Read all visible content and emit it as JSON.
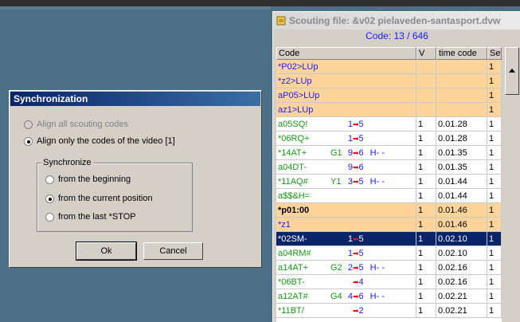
{
  "scouting": {
    "title": "Scouting file: &v02 pielaveden-santasport.dvw",
    "code_counter": "Code: 13 / 646",
    "headers": {
      "code": "Code",
      "v": "V",
      "time": "time code",
      "set": "Set"
    },
    "rows": [
      {
        "code": "*P02>LUp",
        "v": "",
        "time": "",
        "set": "1",
        "style": "orange"
      },
      {
        "code": "*z2>LUp",
        "v": "",
        "time": "",
        "set": "1",
        "style": "orange"
      },
      {
        "code": "aP05>LUp",
        "v": "",
        "time": "",
        "set": "1",
        "style": "orange"
      },
      {
        "code": "az1>LUp",
        "v": "",
        "time": "",
        "set": "1",
        "style": "orange"
      },
      {
        "code": "a05SQ!",
        "p1": "",
        "p2": "1",
        "p3": "5",
        "extra": "",
        "v": "1",
        "time": "0.01.28",
        "set": "1",
        "style": "white"
      },
      {
        "code": "*06RQ+",
        "p1": "",
        "p2": "1",
        "p3": "5",
        "extra": "",
        "v": "1",
        "time": "0.01.28",
        "set": "1",
        "style": "white"
      },
      {
        "code": "*14AT+",
        "p1": "G1",
        "p2": "9",
        "p3": "6",
        "extra": "H- -",
        "v": "1",
        "time": "0.01.35",
        "set": "1",
        "style": "white"
      },
      {
        "code": "a04DT-",
        "p1": "",
        "p2": "9",
        "p3": "6",
        "extra": "",
        "v": "1",
        "time": "0.01.35",
        "set": "1",
        "style": "white"
      },
      {
        "code": "*11AQ#",
        "p1": "Y1",
        "p2": "3",
        "p3": "5",
        "extra": "H- -",
        "v": "1",
        "time": "0.01.44",
        "set": "1",
        "style": "white"
      },
      {
        "code": "a$$&H=",
        "p1": "",
        "p2": "",
        "p3": "",
        "extra": "",
        "v": "1",
        "time": "0.01.44",
        "set": "1",
        "style": "white"
      },
      {
        "code": "*p01:00",
        "v": "1",
        "time": "0.01.46",
        "set": "1",
        "style": "orange-bold"
      },
      {
        "code": "*z1",
        "v": "1",
        "time": "0.01.46",
        "set": "1",
        "style": "orange"
      },
      {
        "code": "*02SM-",
        "p1": "",
        "p2": "1",
        "p3": "5",
        "extra": "",
        "v": "1",
        "time": "0.02.10",
        "set": "1",
        "style": "sel"
      },
      {
        "code": "a04RM#",
        "p1": "",
        "p2": "1",
        "p3": "5",
        "extra": "",
        "v": "1",
        "time": "0.02.10",
        "set": "1",
        "style": "white"
      },
      {
        "code": "a14AT+",
        "p1": "G2",
        "p2": "2",
        "p3": "5",
        "extra": "H- -",
        "v": "1",
        "time": "0.02.16",
        "set": "1",
        "style": "white"
      },
      {
        "code": "*06BT-",
        "p1": "",
        "p2": "",
        "p3": "4",
        "extra": "",
        "v": "1",
        "time": "0.02.16",
        "set": "1",
        "style": "white"
      },
      {
        "code": "a12AT#",
        "p1": "G4",
        "p2": "4",
        "p3": "6",
        "extra": "H- -",
        "v": "1",
        "time": "0.02.21",
        "set": "1",
        "style": "white"
      },
      {
        "code": "*11BT/",
        "p1": "",
        "p2": "",
        "p3": "2",
        "extra": "",
        "v": "1",
        "time": "0.02.21",
        "set": "1",
        "style": "white"
      }
    ],
    "arrow_glyph": "➡"
  },
  "dialog": {
    "title": "Synchronization",
    "align_all": "Align all scouting codes",
    "align_video": "Align only the codes of the video [1]",
    "group_label": "Synchronize",
    "from_beginning": "from the beginning",
    "from_current": "from the current position",
    "from_last_stop": "from the last *STOP",
    "ok": "Ok",
    "cancel": "Cancel"
  },
  "colors": {
    "desktop": "#4b6f86",
    "orange_row": "#fed49b",
    "selected_row": "#0a246a",
    "code_green": "#179a17",
    "code_blue": "#1a1aff",
    "arrow_red": "#ee1111"
  }
}
